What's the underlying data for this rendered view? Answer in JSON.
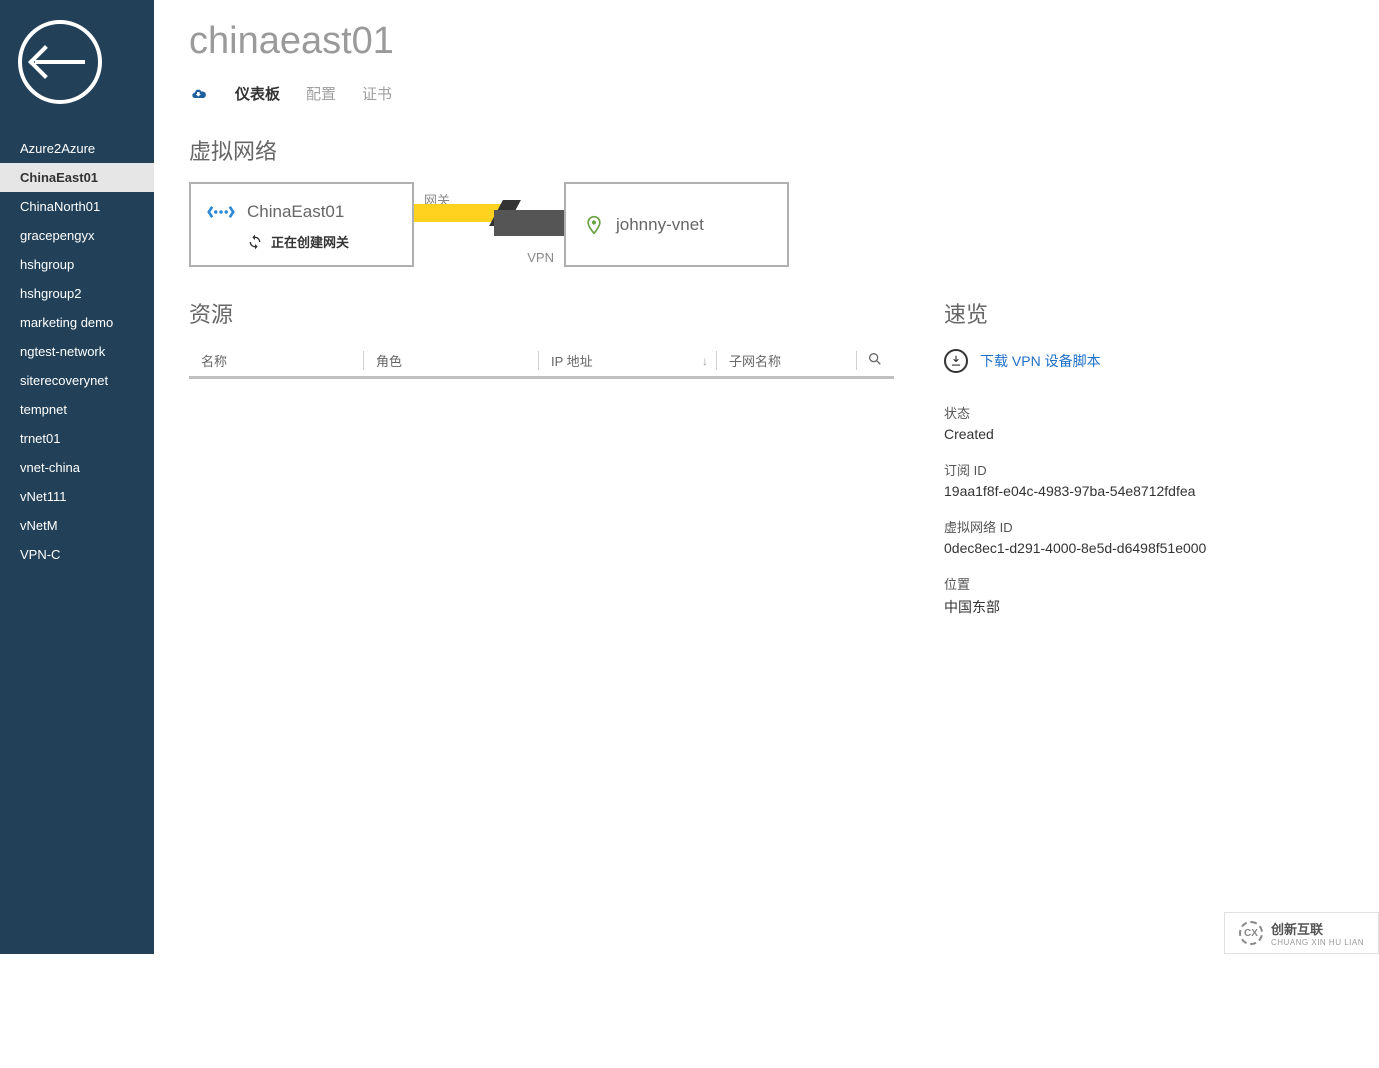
{
  "page_title": "chinaeast01",
  "tabs": {
    "dashboard": "仪表板",
    "configure": "配置",
    "certificates": "证书"
  },
  "sections": {
    "vnet": "虚拟网络",
    "resources": "资源",
    "quick": "速览"
  },
  "sidebar": {
    "items": [
      "Azure2Azure",
      "ChinaEast01",
      "ChinaNorth01",
      "gracepengyx",
      "hshgroup",
      "hshgroup2",
      "marketing demo",
      "ngtest-network",
      "siterecoverynet",
      "tempnet",
      "trnet01",
      "vnet-china",
      "vNet111",
      "vNetM",
      "VPN-C"
    ],
    "active_index": 1
  },
  "vnet_diagram": {
    "left_name": "ChinaEast01",
    "left_status": "正在创建网关",
    "gateway_label": "网关",
    "vpn_label": "VPN",
    "right_name": "johnny-vnet"
  },
  "table": {
    "headers": {
      "name": "名称",
      "role": "角色",
      "ip": "IP 地址",
      "subnet": "子网名称"
    }
  },
  "quick": {
    "download_link": "下载 VPN 设备脚本",
    "status_label": "状态",
    "status_value": "Created",
    "sub_label": "订阅 ID",
    "sub_value": "19aa1f8f-e04c-4983-97ba-54e8712fdfea",
    "vnet_id_label": "虚拟网络 ID",
    "vnet_id_value": "0dec8ec1-d291-4000-8e5d-d6498f51e000",
    "location_label": "位置",
    "location_value": "中国东部"
  },
  "watermark": {
    "brand": "创新互联",
    "sub": "CHUANG XIN HU LIAN"
  }
}
